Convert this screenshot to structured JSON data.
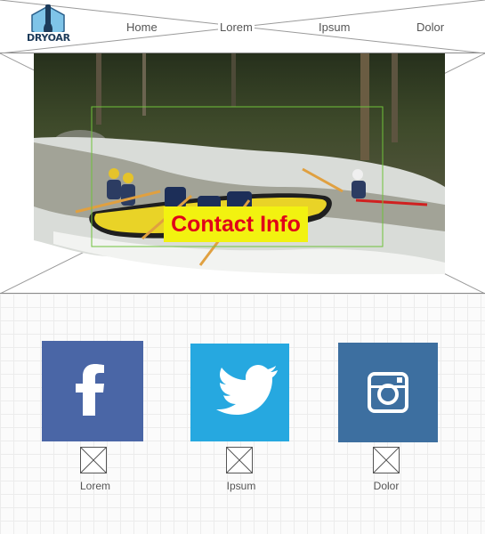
{
  "header": {
    "logo_text": "DRYOAR",
    "nav": [
      "Home",
      "Lorem",
      "Ipsum",
      "Dolor"
    ]
  },
  "hero": {
    "contact_label": "Contact Info"
  },
  "social": [
    {
      "icon": "facebook-icon",
      "color": "#4a66a6",
      "label": "Lorem"
    },
    {
      "icon": "twitter-icon",
      "color": "#26a8e0",
      "label": "Ipsum"
    },
    {
      "icon": "instagram-icon",
      "color": "#3d6fa0",
      "label": "Dolor"
    }
  ],
  "colors": {
    "contact_bg": "#f2f210",
    "contact_text": "#e0001a"
  }
}
